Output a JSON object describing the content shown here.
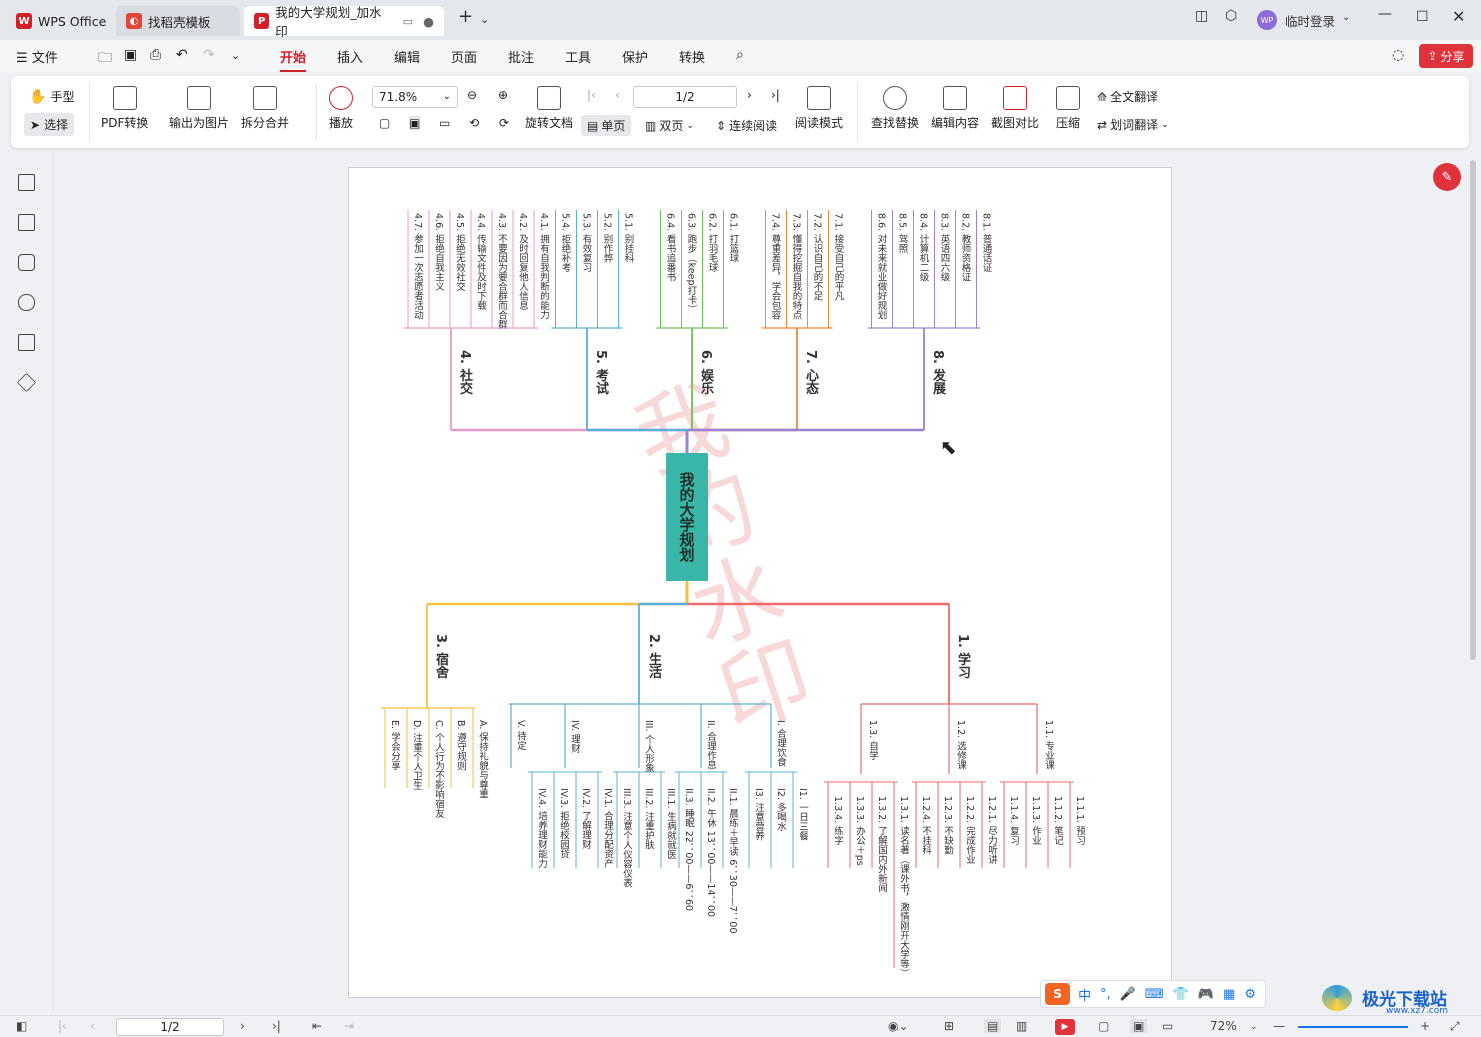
{
  "tabs": [
    {
      "label": "WPS Office"
    },
    {
      "label": "找稻壳模板"
    },
    {
      "label": "我的大学规划_加水印"
    }
  ],
  "title_right": {
    "login": "临时登录",
    "avatar": "WP"
  },
  "menu": {
    "file": "文件",
    "items": [
      "开始",
      "插入",
      "编辑",
      "页面",
      "批注",
      "工具",
      "保护",
      "转换"
    ],
    "share": "分享"
  },
  "ribbon": {
    "hand": "手型",
    "select": "选择",
    "pdf_convert": "PDF转换",
    "export_image": "输出为图片",
    "split_merge": "拆分合并",
    "play": "播放",
    "zoom": "71.8%",
    "page": "1/2",
    "rotate": "旋转文档",
    "single": "单页",
    "double": "双页",
    "continuous": "连续阅读",
    "read_mode": "阅读模式",
    "find_replace": "查找替换",
    "edit_content": "编辑内容",
    "crop_compare": "截图对比",
    "compress": "压缩",
    "full_translate": "全文翻译",
    "word_translate": "划词翻译"
  },
  "mindmap": {
    "center": "我的大学规划",
    "watermark": "我的水印",
    "top_branches": [
      {
        "title": "4. 社交",
        "color": "#e89ac8",
        "items": [
          "4.7. 参加一次志愿者活动",
          "4.6. 拒绝自我主义",
          "4.5. 拒绝无效社交",
          "4.4. 传输文件及时下载",
          "4.3. 不要因为要合群而合群",
          "4.2. 及时回复他人信息",
          "4.1. 拥有自我判断的能力"
        ]
      },
      {
        "title": "5. 考试",
        "color": "#5ab0d8",
        "items": [
          "5.4. 拒绝补考",
          "5.3. 有效复习",
          "5.2. 别作弊",
          "5.1. 别挂科"
        ]
      },
      {
        "title": "6. 娱乐",
        "color": "#6cc25a",
        "items": [
          "6.4. 看书追番书",
          "6.3. 跑步（keep打卡）",
          "6.2. 打羽毛球",
          "6.1. 打篮球"
        ]
      },
      {
        "title": "7. 心态",
        "color": "#f0873a",
        "items": [
          "7.4. 尊重差异，学会包容",
          "7.3. 懂得挖掘自我的特点",
          "7.2. 认识自己的不足",
          "7.1. 接受自己的平凡"
        ]
      },
      {
        "title": "8. 发展",
        "color": "#9a82d8",
        "items": [
          "8.6. 对未来就业做好规划",
          "8.5. 驾照",
          "8.4. 计算机二级",
          "8.3. 英语四六级",
          "8.2. 教师资格证",
          "8.1. 普通话证"
        ]
      }
    ],
    "bottom_branches": [
      {
        "title": "3. 宿舍",
        "color": "#f5c242",
        "items": [
          "E. 学会分享",
          "D. 注重个人卫生",
          "C. 个人行为不影响宿友",
          "B. 遵守规则",
          "A. 保持礼貌与尊重"
        ]
      },
      {
        "title": "2. 生活",
        "color": "#5ab0d8",
        "subs": [
          {
            "title": "V. 待定",
            "items": []
          },
          {
            "title": "IV. 理财",
            "items": [
              "IV.4. 培养理财能力",
              "IV.3. 拒绝校园贷",
              "IV.2. 了解理财",
              "IV.1. 合理分配资产"
            ]
          },
          {
            "title": "III. 个人形象",
            "items": [
              "III.3. 注意个人仪容仪表",
              "III.2. 注重护肤",
              "III.1. 生病就就医"
            ]
          },
          {
            "title": "II. 合理作息",
            "items": [
              "II.3. 睡眠 22：00——6：60",
              "II.2. 午休 13：00——14：00",
              "II.1. 晨练＋早读 6：30——7：00"
            ]
          },
          {
            "title": "I. 合理饮食",
            "items": [
              "I3. 注意营养",
              "I2. 多喝水",
              "I1. 一日三餐"
            ]
          }
        ]
      },
      {
        "title": "1. 学习",
        "color": "#ee6b6b",
        "subs": [
          {
            "title": "1.3. 自学",
            "items": [
              "1.3.4. 练字",
              "1.3.3. 办公＋ps",
              "1.3.2. 了解国内外新闻",
              "1.3.1. 读名著（课外书，激情刚开大学等）"
            ]
          },
          {
            "title": "1.2. 选修课",
            "items": [
              "1.2.4. 不挂科",
              "1.2.3. 不缺勤",
              "1.2.2. 完成作业",
              "1.2.1. 尽力听讲"
            ]
          },
          {
            "title": "1.1. 专业课",
            "items": [
              "1.1.4. 复习",
              "1.1.3. 作业",
              "1.1.2. 笔记",
              "1.1.1. 预习"
            ]
          }
        ]
      }
    ]
  },
  "ime": [
    "中",
    "°,",
    "🎤",
    "⌨",
    "👕",
    "🎮",
    "▦",
    "⚙"
  ],
  "status": {
    "page": "1/2",
    "zoom": "72%"
  },
  "footer_logo": "极光下载站",
  "footer_url": "www.xz7.com"
}
